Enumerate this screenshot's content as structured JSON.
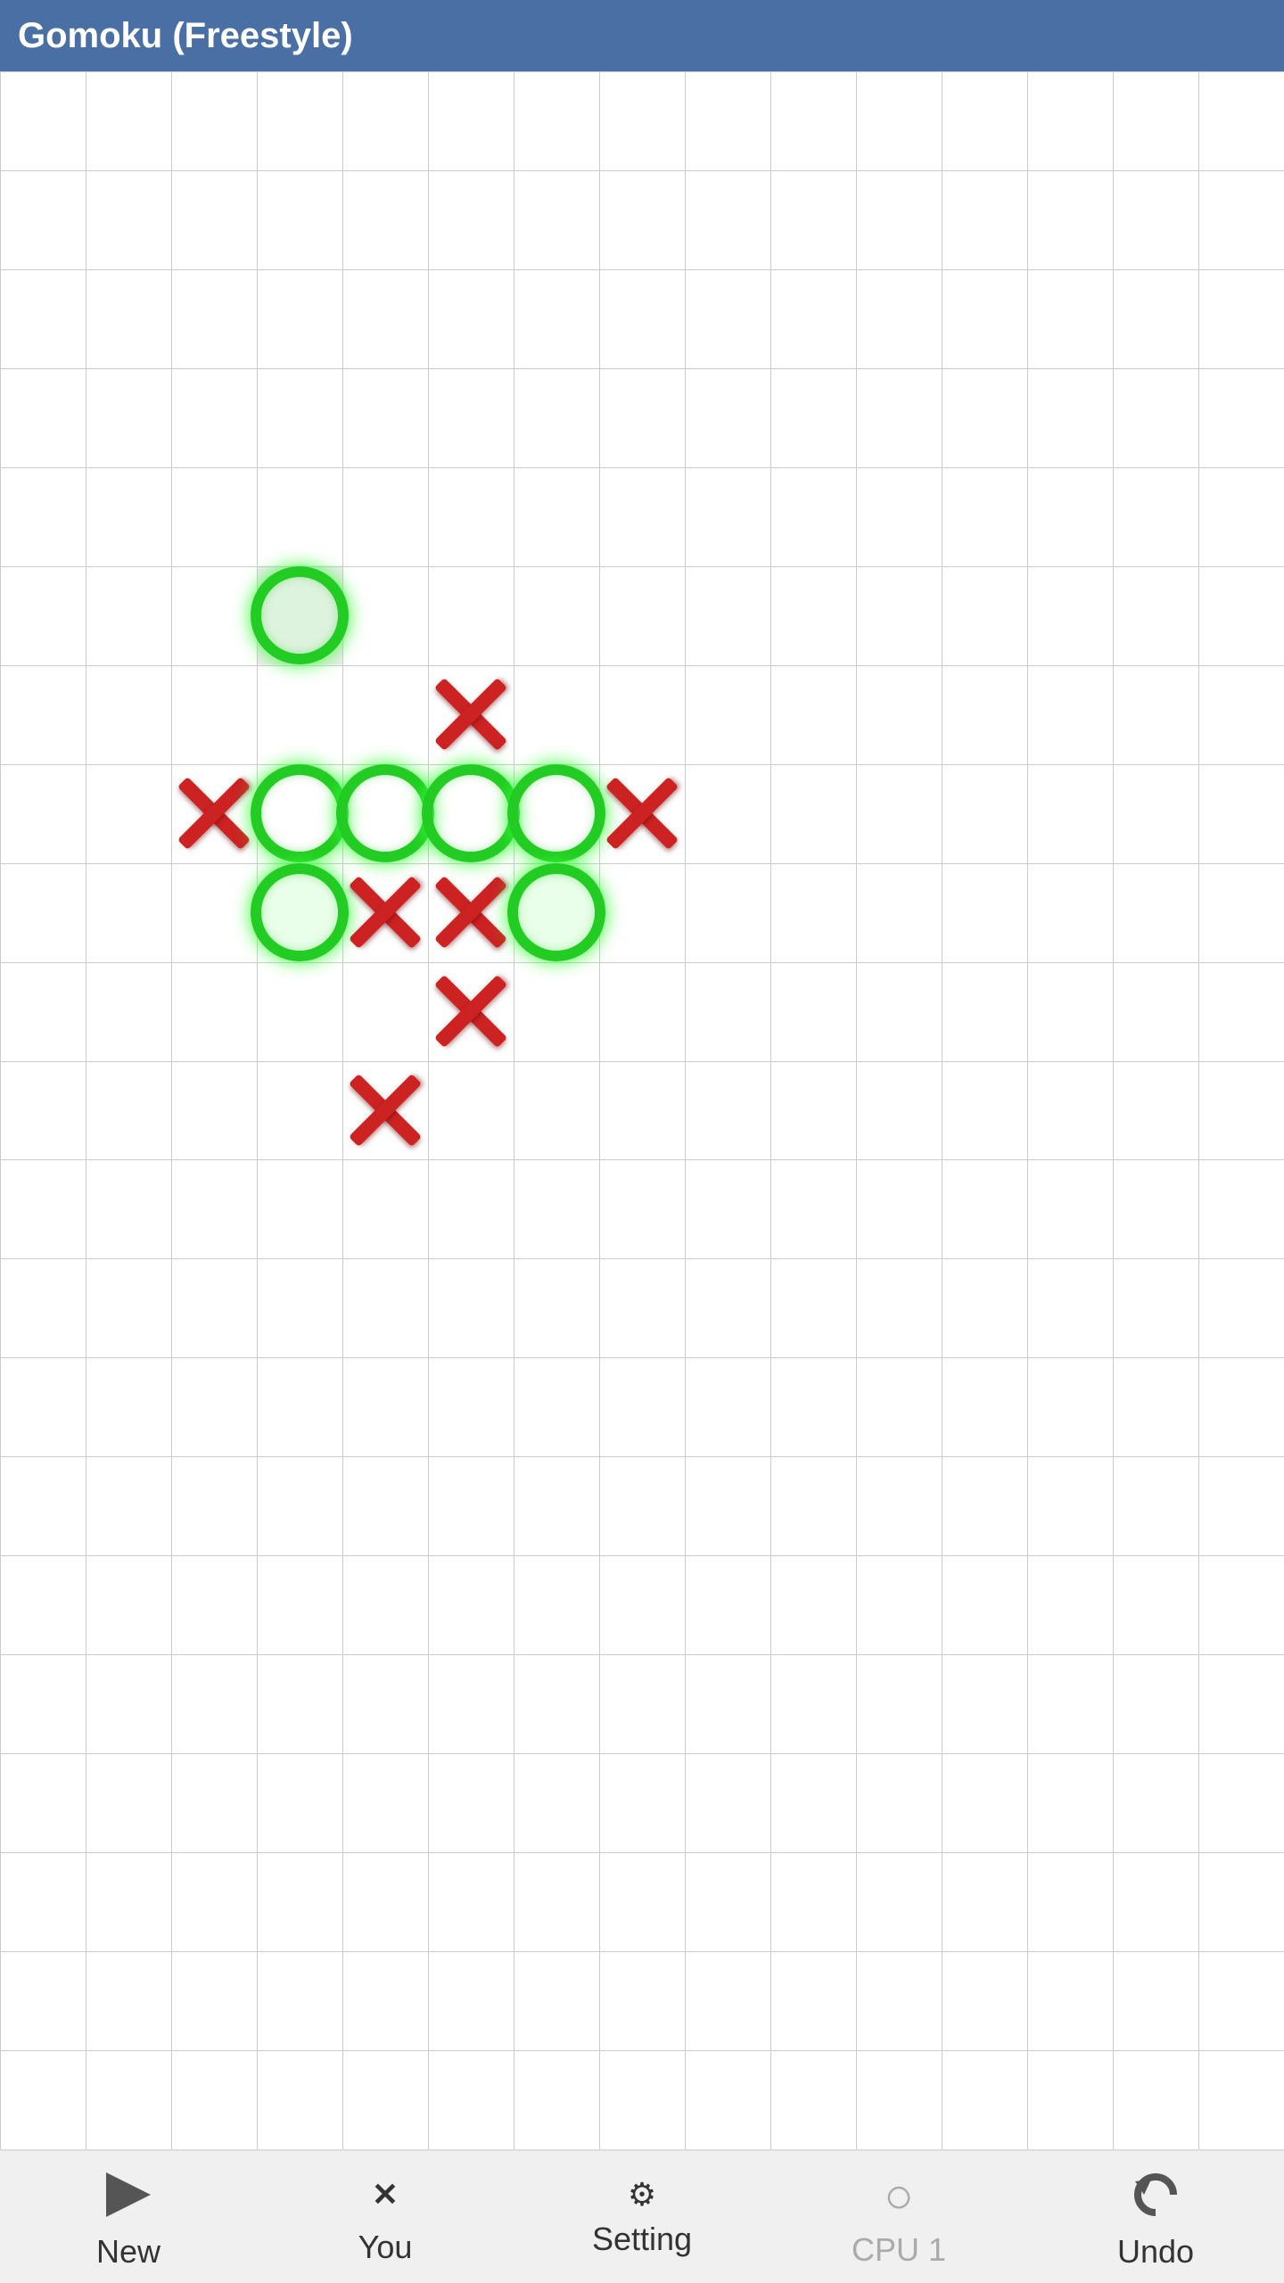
{
  "title": "Gomoku (Freestyle)",
  "board": {
    "cols": 15,
    "rows": 21,
    "cell_size_px": 95
  },
  "pieces": [
    {
      "type": "O",
      "col": 3,
      "row": 5,
      "highlight": true
    },
    {
      "type": "X",
      "col": 5,
      "row": 6,
      "highlight": false
    },
    {
      "type": "X",
      "col": 2,
      "row": 7,
      "highlight": false
    },
    {
      "type": "O",
      "col": 3,
      "row": 7,
      "highlight": false
    },
    {
      "type": "O",
      "col": 4,
      "row": 7,
      "highlight": false
    },
    {
      "type": "O",
      "col": 5,
      "row": 7,
      "highlight": false
    },
    {
      "type": "O",
      "col": 6,
      "row": 7,
      "highlight": false
    },
    {
      "type": "X",
      "col": 7,
      "row": 7,
      "highlight": false
    },
    {
      "type": "O",
      "col": 3,
      "row": 8,
      "highlight": true
    },
    {
      "type": "X",
      "col": 4,
      "row": 8,
      "highlight": false
    },
    {
      "type": "X",
      "col": 5,
      "row": 8,
      "highlight": false
    },
    {
      "type": "O",
      "col": 6,
      "row": 8,
      "highlight": true
    },
    {
      "type": "X",
      "col": 5,
      "row": 9,
      "highlight": false
    },
    {
      "type": "X",
      "col": 4,
      "row": 10,
      "highlight": false
    }
  ],
  "highlight_cell": {
    "col": 3,
    "row": 5
  },
  "bottom_bar": {
    "new_label": "New",
    "you_label": "You",
    "setting_label": "Setting",
    "cpu1_label": "CPU 1",
    "undo_label": "Undo"
  },
  "colors": {
    "title_bg": "#4a6fa5",
    "grid_line": "#cccccc",
    "o_color": "#22cc22",
    "x_color": "#cc2222",
    "bg": "#ffffff",
    "bottom_bar_bg": "#f0f0f0"
  }
}
